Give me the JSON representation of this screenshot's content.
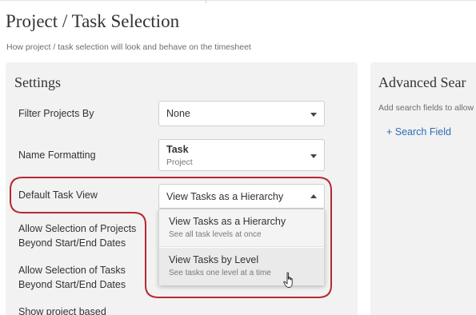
{
  "page": {
    "title": "Project / Task Selection",
    "subtitle": "How project / task selection will look and behave on the timesheet"
  },
  "settings": {
    "title": "Settings",
    "filter_projects": {
      "label": "Filter Projects By",
      "value": "None"
    },
    "name_formatting": {
      "label": "Name Formatting",
      "value": "Task",
      "sub": "Project"
    },
    "default_task_view": {
      "label": "Default Task View",
      "value": "View Tasks as a Hierarchy",
      "options": [
        {
          "title": "View Tasks as a Hierarchy",
          "subtitle": "See all task levels at once"
        },
        {
          "title": "View Tasks by Level",
          "subtitle": "See tasks one level at a time"
        }
      ]
    },
    "allow_projects": {
      "line1": "Allow Selection of Projects",
      "line2": "Beyond Start/End Dates"
    },
    "allow_tasks": {
      "line1": "Allow Selection of Tasks",
      "line2": "Beyond Start/End Dates"
    },
    "show_project": {
      "line1": "Show project based"
    }
  },
  "advanced": {
    "title": "Advanced Sear",
    "hint": "Add search fields to allow",
    "add_field": "+ Search Field"
  },
  "colors": {
    "panel_bg": "#f2f2f2",
    "link": "#2f6db7",
    "highlight": "#b72834"
  },
  "icons": {
    "dropdown_caret": "caret-down-icon",
    "open_caret": "caret-up-icon",
    "cursor": "hand-cursor-icon"
  }
}
